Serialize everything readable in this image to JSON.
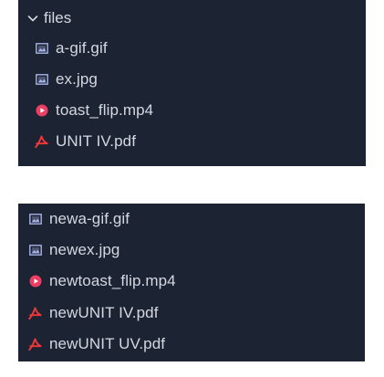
{
  "explorer_top": {
    "folder": {
      "label": "files",
      "expanded": true,
      "icon": "chevron-down-icon"
    },
    "items": [
      {
        "label": "a-gif.gif",
        "icon": "image-icon",
        "icon_color": "#a7b2e6"
      },
      {
        "label": "ex.jpg",
        "icon": "image-icon",
        "icon_color": "#a7b2e6"
      },
      {
        "label": "toast_flip.mp4",
        "icon": "play-icon",
        "icon_color": "#ec3d63"
      },
      {
        "label": "UNIT IV.pdf",
        "icon": "pdf-icon",
        "icon_color": "#f2373b"
      }
    ]
  },
  "explorer_bottom": {
    "items": [
      {
        "label": "newa-gif.gif",
        "icon": "image-icon",
        "icon_color": "#a7b2e6"
      },
      {
        "label": "newex.jpg",
        "icon": "image-icon",
        "icon_color": "#a7b2e6"
      },
      {
        "label": "newtoast_flip.mp4",
        "icon": "play-icon",
        "icon_color": "#ec3d63"
      },
      {
        "label": "newUNIT IV.pdf",
        "icon": "pdf-icon",
        "icon_color": "#f2373b"
      },
      {
        "label": "newUNIT UV.pdf",
        "icon": "pdf-icon",
        "icon_color": "#f2373b"
      }
    ]
  },
  "colors": {
    "panel_bg": "#1c2332",
    "text": "#d4d8e2",
    "page_bg": "#ffffff"
  }
}
